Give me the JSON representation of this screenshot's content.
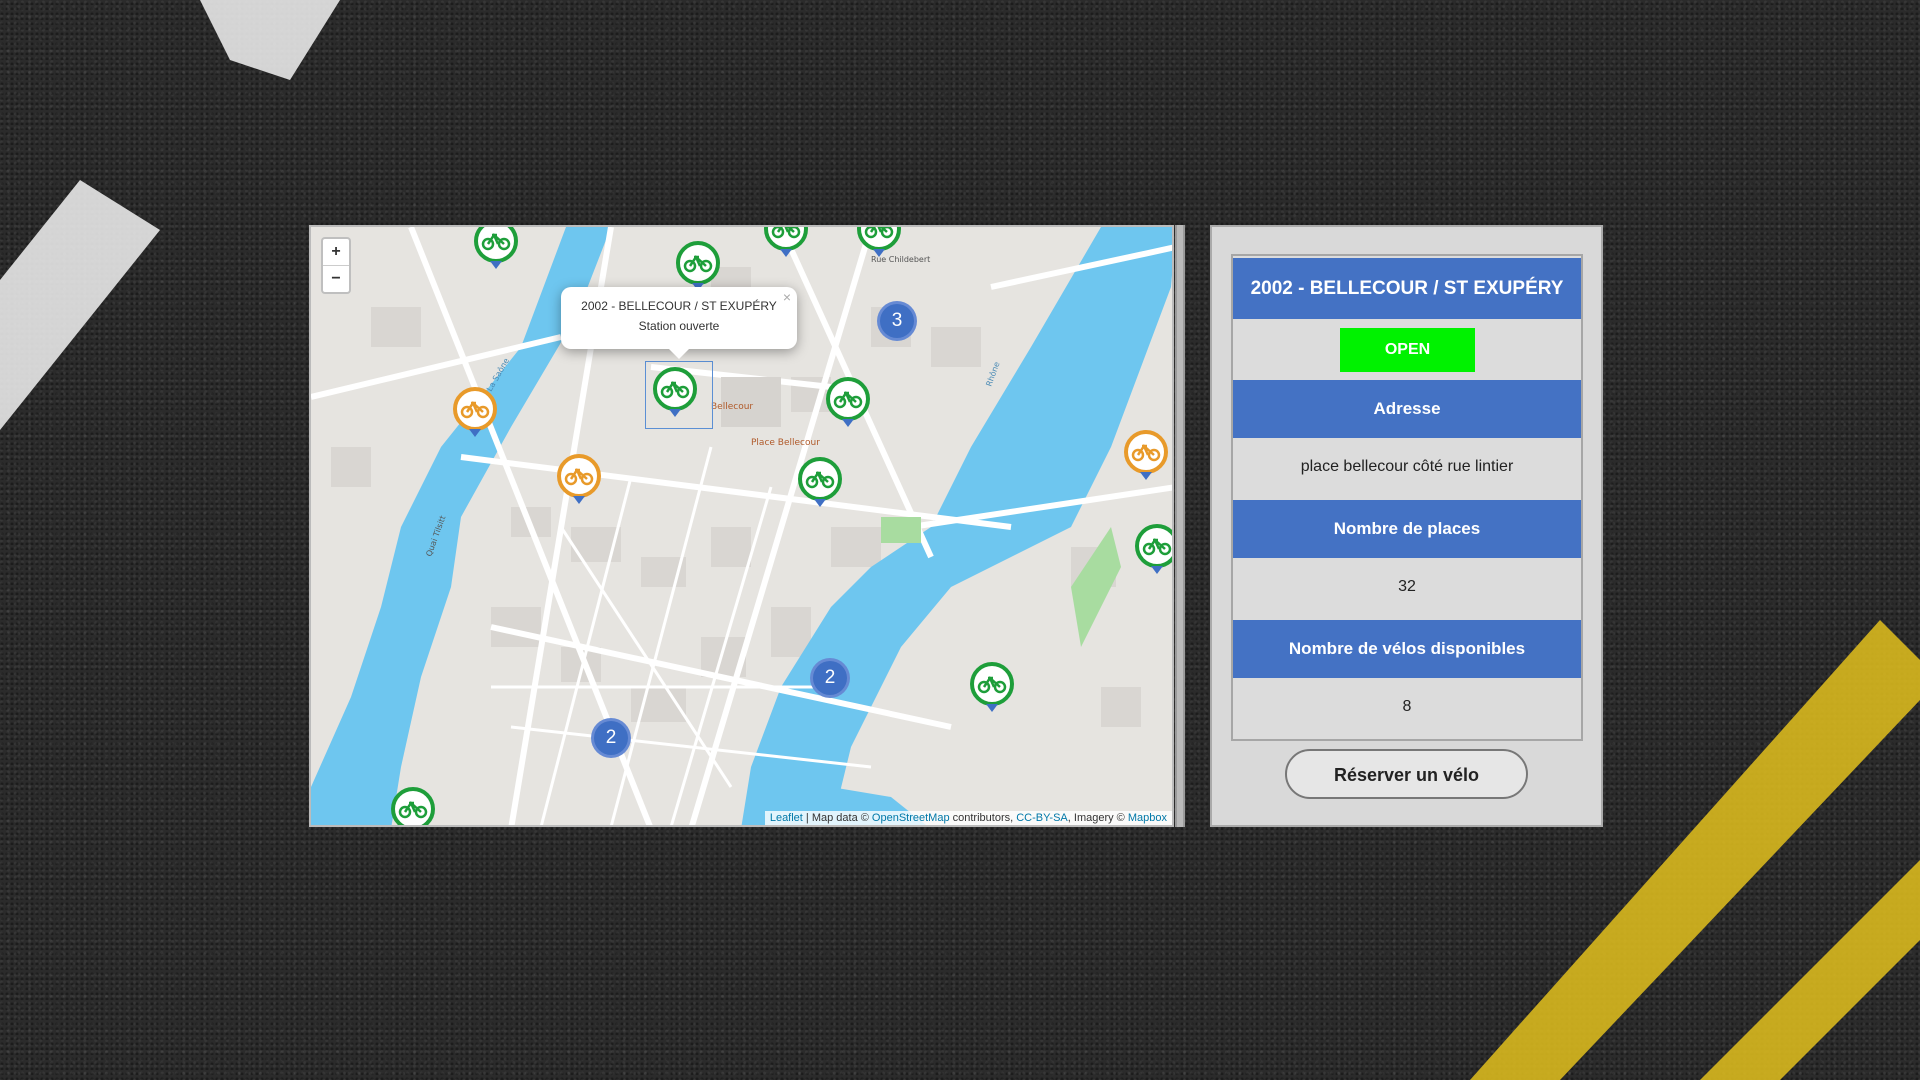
{
  "map": {
    "zoom_in": "+",
    "zoom_out": "−",
    "popup": {
      "title": "2002 - BELLECOUR / ST EXUPÉRY",
      "status": "Station ouverte",
      "close": "×"
    },
    "clusters": [
      "3",
      "2",
      "2"
    ],
    "attribution": {
      "leaflet": "Leaflet",
      "sep1": " | Map data © ",
      "osm": "OpenStreetMap",
      "sep2": " contributors, ",
      "license": "CC-BY-SA",
      "sep3": ", Imagery © ",
      "mapbox": "Mapbox"
    },
    "street_labels": [
      "Bellecour",
      "Place Bellecour",
      "La Saône",
      "Rhône",
      "Quai Tilsitt",
      "Rue Childebert"
    ],
    "colors": {
      "water": "#6ec6ef",
      "land": "#e6e4e0",
      "road": "#ffffff",
      "marker_green": "#1e9e3a",
      "marker_orange": "#e89a2a",
      "cluster": "#3f6fc4"
    }
  },
  "station": {
    "title": "2002 - BELLECOUR / ST EXUPÉRY",
    "status": "OPEN",
    "address_label": "Adresse",
    "address_value": "place bellecour côté rue lintier",
    "places_label": "Nombre de places",
    "places_value": "32",
    "bikes_label": "Nombre de vélos disponibles",
    "bikes_value": "8",
    "reserve_button": "Réserver un vélo",
    "colors": {
      "header": "#4472c4",
      "open": "#00f200"
    }
  }
}
